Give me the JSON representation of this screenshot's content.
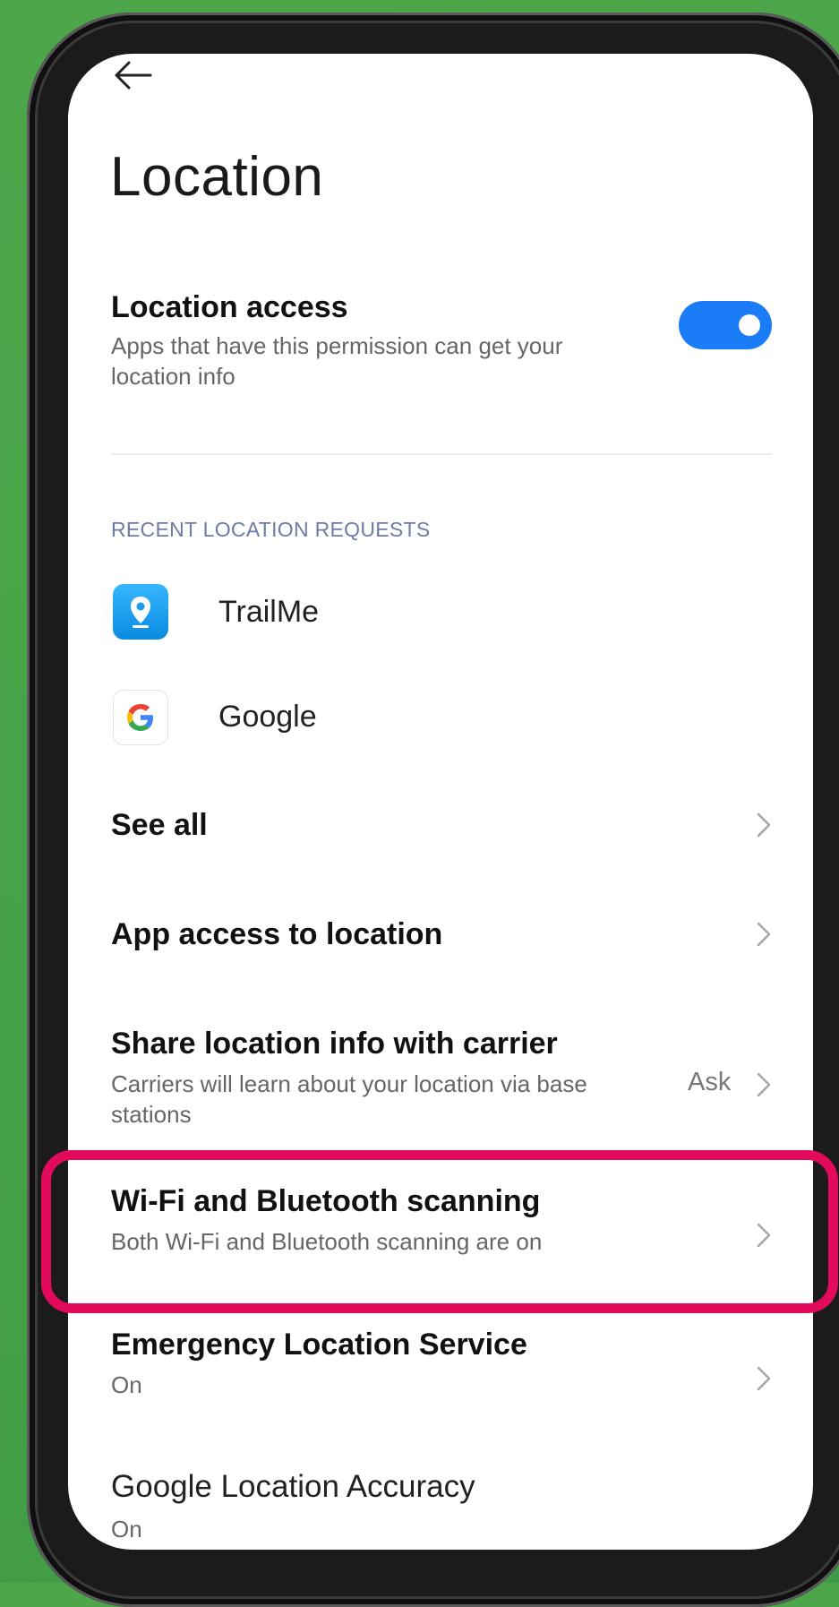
{
  "header": {
    "back_icon": "arrow-left-icon",
    "title": "Location"
  },
  "location_access": {
    "title": "Location access",
    "subtitle_line1": "Apps that have this permission can get your",
    "subtitle_line2": "location info",
    "toggle_on": true
  },
  "recent": {
    "header": "RECENT LOCATION REQUESTS",
    "apps": [
      {
        "name": "TrailMe",
        "icon": "location-pin-icon"
      },
      {
        "name": "Google",
        "icon": "google-g-icon"
      }
    ]
  },
  "settings": [
    {
      "title": "See all"
    },
    {
      "title": "App access to location"
    },
    {
      "title": "Share location info with carrier",
      "subtitle_line1": "Carriers will learn about your location via base",
      "subtitle_line2": "stations",
      "value": "Ask"
    },
    {
      "title": "Wi-Fi and Bluetooth scanning",
      "subtitle_line1": "Both Wi-Fi and Bluetooth scanning are on"
    },
    {
      "title": "Emergency Location Service",
      "subtitle_line1": "On"
    },
    {
      "title": "Google Location Accuracy",
      "subtitle_line1": "On"
    }
  ],
  "colors": {
    "accent": "#1a7cf7",
    "highlight": "#e20a5a",
    "background": "#46a247"
  }
}
